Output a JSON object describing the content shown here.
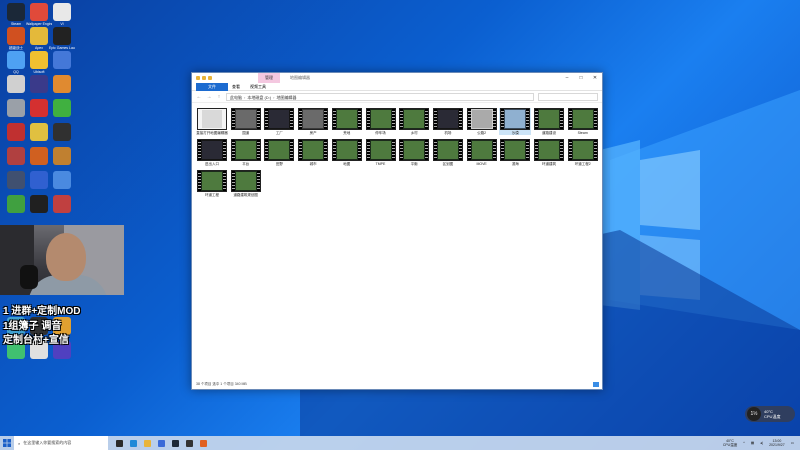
{
  "desktop_icons": [
    {
      "label": "Steam",
      "color": "#1b2838"
    },
    {
      "label": "Wallpaper Engine",
      "color": "#e04a3a"
    },
    {
      "label": "VI",
      "color": "#e8e8e8"
    },
    {
      "label": "超级战士",
      "color": "#d05020"
    },
    {
      "label": "Apex",
      "color": "#e4b93a"
    },
    {
      "label": "Epic Games Launcher",
      "color": "#222222"
    },
    {
      "label": "QQ",
      "color": "#4ea1f3"
    },
    {
      "label": "Ubisoft",
      "color": "#f0c030"
    },
    {
      "label": "",
      "color": "#4478d8"
    },
    {
      "label": "",
      "color": "#d0d0d0"
    },
    {
      "label": "",
      "color": "#3a3a8a"
    },
    {
      "label": "",
      "color": "#e08a30"
    },
    {
      "label": "",
      "color": "#9aa0a8"
    },
    {
      "label": "",
      "color": "#d43030"
    },
    {
      "label": "",
      "color": "#40b040"
    },
    {
      "label": "",
      "color": "#c03030"
    },
    {
      "label": "",
      "color": "#e0c040"
    },
    {
      "label": "",
      "color": "#303030"
    },
    {
      "label": "",
      "color": "#b04040"
    },
    {
      "label": "",
      "color": "#d06020"
    },
    {
      "label": "",
      "color": "#c08030"
    },
    {
      "label": "",
      "color": "#405070"
    },
    {
      "label": "",
      "color": "#3060d0"
    },
    {
      "label": "",
      "color": "#4a8ae0"
    },
    {
      "label": "",
      "color": "#40a040"
    },
    {
      "label": "",
      "color": "#202020"
    },
    {
      "label": "",
      "color": "#c04040"
    },
    {
      "label": "",
      "color": "#40a0d0"
    },
    {
      "label": "",
      "color": "#303030"
    },
    {
      "label": "",
      "color": "#e0a030"
    },
    {
      "label": "",
      "color": "#40c070"
    },
    {
      "label": "",
      "color": "#e0e0e0"
    },
    {
      "label": "",
      "color": "#5040c0"
    }
  ],
  "overlay": {
    "line1": "1 进群+定制MOD",
    "line2": "1组簿子 调音",
    "line3": "定制台村+宣信"
  },
  "window": {
    "title": "地图编辑器",
    "context_tab": "管理",
    "ribbon": [
      "文件",
      "主页",
      "共享",
      "查看",
      "视频工具"
    ],
    "path": [
      "此电脑",
      "本地磁盘 (D:)",
      "地图编辑器"
    ],
    "status": "38 个项目   选中 1 个项目  340 MB",
    "files": [
      {
        "label": "直接打开地图编辑器",
        "style": "doc"
      },
      {
        "label": "国道",
        "style": "road"
      },
      {
        "label": "工厂",
        "style": "dark"
      },
      {
        "label": "房产",
        "style": "road"
      },
      {
        "label": "荒地",
        "style": "green"
      },
      {
        "label": "停车场",
        "style": "green"
      },
      {
        "label": "乡村",
        "style": "green"
      },
      {
        "label": "机场",
        "style": "dark"
      },
      {
        "label": "公路2",
        "style": "grey"
      },
      {
        "label": "沙漠",
        "style": "sky"
      },
      {
        "label": "道路建设",
        "style": "green"
      },
      {
        "label": "Steam",
        "style": "green"
      },
      {
        "label": "进出入口",
        "style": "dark"
      },
      {
        "label": "平台",
        "style": "green"
      },
      {
        "label": "田野",
        "style": "green"
      },
      {
        "label": "城市",
        "style": "green"
      },
      {
        "label": "地图",
        "style": "green"
      },
      {
        "label": "TMPE",
        "style": "green"
      },
      {
        "label": "平衡",
        "style": "green"
      },
      {
        "label": "区划图",
        "style": "green"
      },
      {
        "label": "MOVE",
        "style": "green"
      },
      {
        "label": "滨海",
        "style": "green"
      },
      {
        "label": "环道建筑",
        "style": "green"
      },
      {
        "label": "环道工程2",
        "style": "green"
      },
      {
        "label": "环道工程",
        "style": "green"
      },
      {
        "label": "道路建筑规划图",
        "style": "green"
      }
    ]
  },
  "taskbar": {
    "search_placeholder": "在这里输入你要搜索的内容",
    "apps": [
      {
        "name": "task-view-icon",
        "color": "#2a2a2a"
      },
      {
        "name": "edge-icon",
        "color": "#1f8ad8"
      },
      {
        "name": "folder-icon",
        "color": "#e8b43a"
      },
      {
        "name": "store-icon",
        "color": "#3a6ad8"
      },
      {
        "name": "steam-icon",
        "color": "#1b2838"
      },
      {
        "name": "game-icon",
        "color": "#333333"
      },
      {
        "name": "app-icon",
        "color": "#e06020"
      }
    ],
    "weather_temp": "40°C",
    "weather_text": "CPU温度",
    "time": "13:00",
    "date": "2021/9/27"
  },
  "toast": {
    "badge": "1½",
    "line1": "40°C",
    "line2": "CPU温度"
  }
}
